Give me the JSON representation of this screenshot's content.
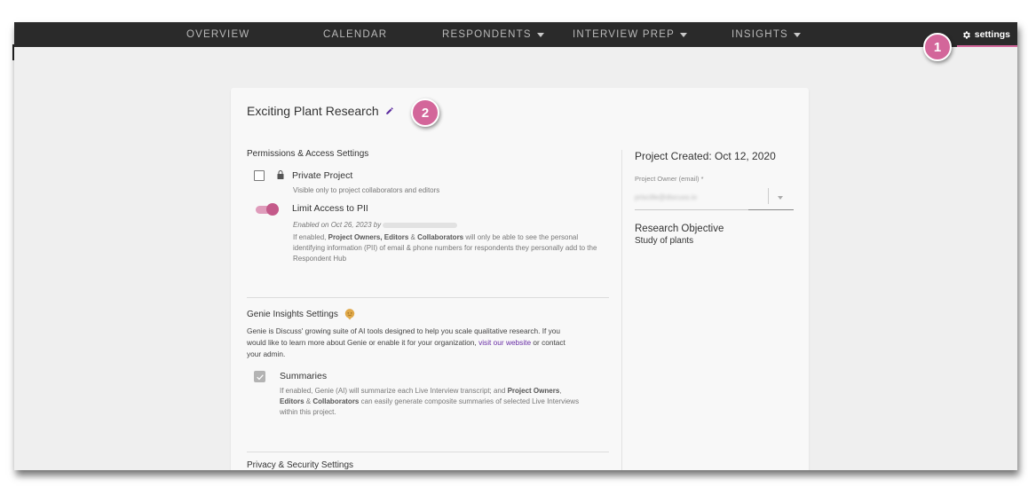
{
  "nav": {
    "items": [
      {
        "label": "OVERVIEW",
        "has_caret": false
      },
      {
        "label": "CALENDAR",
        "has_caret": false
      },
      {
        "label": "RESPONDENTS",
        "has_caret": true
      },
      {
        "label": "INTERVIEW PREP",
        "has_caret": true
      },
      {
        "label": "INSIGHTS",
        "has_caret": true
      }
    ],
    "settings_label": "settings",
    "settings_icon": "gear-icon"
  },
  "project": {
    "title": "Exciting Plant Research",
    "edit_icon": "pencil-icon"
  },
  "permissions": {
    "heading": "Permissions & Access Settings",
    "private_project": {
      "label": "Private Project",
      "checked": false,
      "icon": "lock-icon",
      "description": "Visible only to project collaborators and editors"
    },
    "limit_pii": {
      "label": "Limit Access to PII",
      "enabled": true,
      "enabled_on": "Enabled on Oct 26, 2023 by",
      "description_prefix": "If enabled,",
      "description_roles_1": "Project Owners, Editors",
      "description_amp": "&",
      "description_roles_2": "Collaborators",
      "description_suffix": "will only be able to see the personal identifying information (PII) of email & phone numbers for respondents they personally add to the Respondent Hub"
    }
  },
  "genie": {
    "heading": "Genie Insights Settings",
    "icon": "genie-icon",
    "body_prefix": "Genie is Discuss' growing suite of AI tools designed to help you scale qualitative research. If you would like to learn more about Genie or enable it for your organization,",
    "link_text": "visit our website",
    "body_suffix": "or contact your admin.",
    "summaries": {
      "label": "Summaries",
      "checked": true,
      "description_prefix": "If enabled, Genie (AI) will summarize each Live Interview transcript; and",
      "roles_1": "Project Owners",
      "comma": ",",
      "roles_2": "Editors",
      "amp": "&",
      "roles_3": "Collaborators",
      "description_suffix": "can easily generate composite summaries of selected Live Interviews within this project."
    }
  },
  "privacy": {
    "heading": "Privacy & Security Settings"
  },
  "sidebar": {
    "created": "Project Created: Oct 12, 2020",
    "owner_label": "Project Owner (email) *",
    "owner_value": "priscille@discuss.io",
    "objective_heading": "Research Objective",
    "objective_value": "Study of plants"
  },
  "annotations": {
    "badge_1": "1",
    "badge_2": "2"
  },
  "colors": {
    "nav_bg": "#2a2a2a",
    "accent_pink": "#d3669a",
    "link_purple": "#6a2fa6",
    "page_bg": "#efefef"
  }
}
